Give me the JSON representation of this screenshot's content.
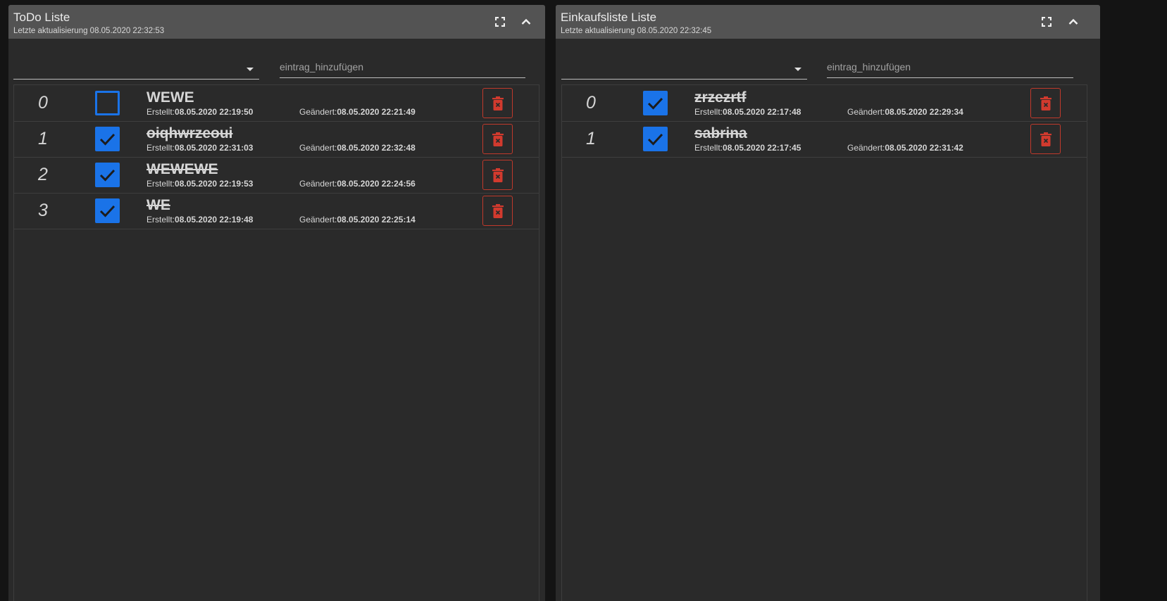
{
  "panels": [
    {
      "title": "ToDo Liste",
      "subtitle": "Letzte aktualisierung 08.05.2020 22:32:53",
      "select_value": "",
      "input_placeholder": "eintrag_hinzufügen",
      "items": [
        {
          "index": "0",
          "name": "WEWE",
          "checked": false,
          "created_label": "Erstellt:",
          "created": "08.05.2020 22:19:50",
          "changed_label": "Geändert:",
          "changed": "08.05.2020 22:21:49"
        },
        {
          "index": "1",
          "name": "oiqhwrzeoui",
          "checked": true,
          "created_label": "Erstellt:",
          "created": "08.05.2020 22:31:03",
          "changed_label": "Geändert:",
          "changed": "08.05.2020 22:32:48"
        },
        {
          "index": "2",
          "name": "WEWEWE",
          "checked": true,
          "created_label": "Erstellt:",
          "created": "08.05.2020 22:19:53",
          "changed_label": "Geändert:",
          "changed": "08.05.2020 22:24:56"
        },
        {
          "index": "3",
          "name": "WE",
          "checked": true,
          "created_label": "Erstellt:",
          "created": "08.05.2020 22:19:48",
          "changed_label": "Geändert:",
          "changed": "08.05.2020 22:25:14"
        }
      ]
    },
    {
      "title": "Einkaufsliste Liste",
      "subtitle": "Letzte aktualisierung 08.05.2020 22:32:45",
      "select_value": "",
      "input_placeholder": "eintrag_hinzufügen",
      "items": [
        {
          "index": "0",
          "name": "zrzezrtf",
          "checked": true,
          "created_label": "Erstellt:",
          "created": "08.05.2020 22:17:48",
          "changed_label": "Geändert:",
          "changed": "08.05.2020 22:29:34"
        },
        {
          "index": "1",
          "name": "sabrina",
          "checked": true,
          "created_label": "Erstellt:",
          "created": "08.05.2020 22:17:45",
          "changed_label": "Geändert:",
          "changed": "08.05.2020 22:31:42"
        }
      ]
    }
  ],
  "icons": {
    "fullscreen": "fullscreen-icon",
    "collapse": "chevron-up-icon",
    "dropdown": "caret-down-icon",
    "checkbox": "checkmark-icon",
    "delete": "trash-icon"
  },
  "colors": {
    "accent": "#1a73e8",
    "danger": "#c0392b",
    "header": "#535353",
    "panel": "#2a2a2a",
    "page": "#141414"
  }
}
